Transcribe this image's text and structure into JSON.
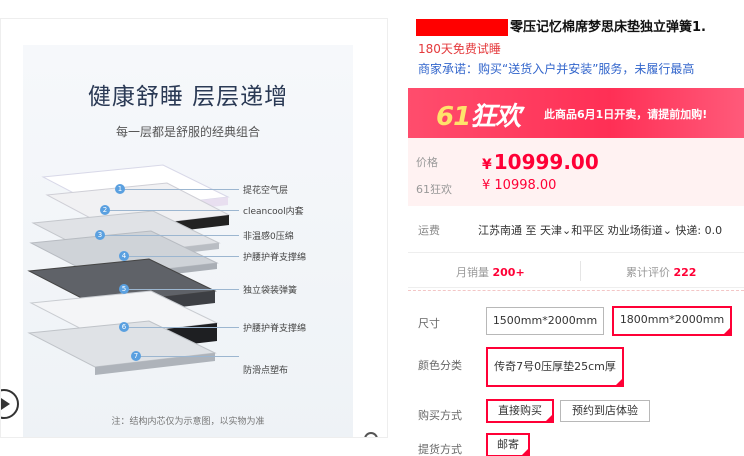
{
  "gallery": {
    "poster_title": "健康舒睡 层层递增",
    "poster_subtitle": "每一层都是舒服的经典组合",
    "layers": [
      {
        "num": "1",
        "label": "提花空气层"
      },
      {
        "num": "2",
        "label": "cleancool内套"
      },
      {
        "num": "3",
        "label": "非温感0压绵"
      },
      {
        "num": "4",
        "label": "护腰护脊支撑绵"
      },
      {
        "num": "5",
        "label": "独立袋装弹簧"
      },
      {
        "num": "6",
        "label": "护腰护脊支撑绵"
      },
      {
        "num": "7",
        "label": "防滑点塑布"
      }
    ],
    "note": "注：结构内芯仅为示意图，以实物为准"
  },
  "product": {
    "title": "零压记忆棉席梦思床垫独立弹簧1.",
    "promo": "180天免费试睡",
    "promise": "商家承诺：购买“送货入户并安装”服务，未履行最高"
  },
  "banner": {
    "logo_num": "61",
    "logo_text": "狂欢",
    "text": "此商品6月1日开卖，请提前加购!"
  },
  "price": {
    "label": "价格",
    "currency": "¥",
    "value": "10999.00",
    "fest_label": "61狂欢",
    "fest_value": "¥ 10998.00"
  },
  "shipping": {
    "label": "运费",
    "text": "江苏南通  至  天津⌄和平区  劝业场街道⌄  快递: 0.0"
  },
  "stats": {
    "sales_label": "月销量",
    "sales_value": "200+",
    "reviews_label": "累计评价",
    "reviews_value": "222"
  },
  "options": {
    "size_label": "尺寸",
    "sizes": [
      "1500mm*2000mm",
      "1800mm*2000mm"
    ],
    "color_label": "颜色分类",
    "colors": [
      "传奇7号0压厚垫25cm厚"
    ],
    "buy_label": "购买方式",
    "buy_options": [
      "直接购买",
      "预约到店体验"
    ],
    "delivery_label": "提货方式",
    "delivery_options": [
      "邮寄"
    ]
  },
  "colors": {
    "accent": "#ff0036",
    "link": "#3366cc",
    "banner": "#ff2f55"
  }
}
